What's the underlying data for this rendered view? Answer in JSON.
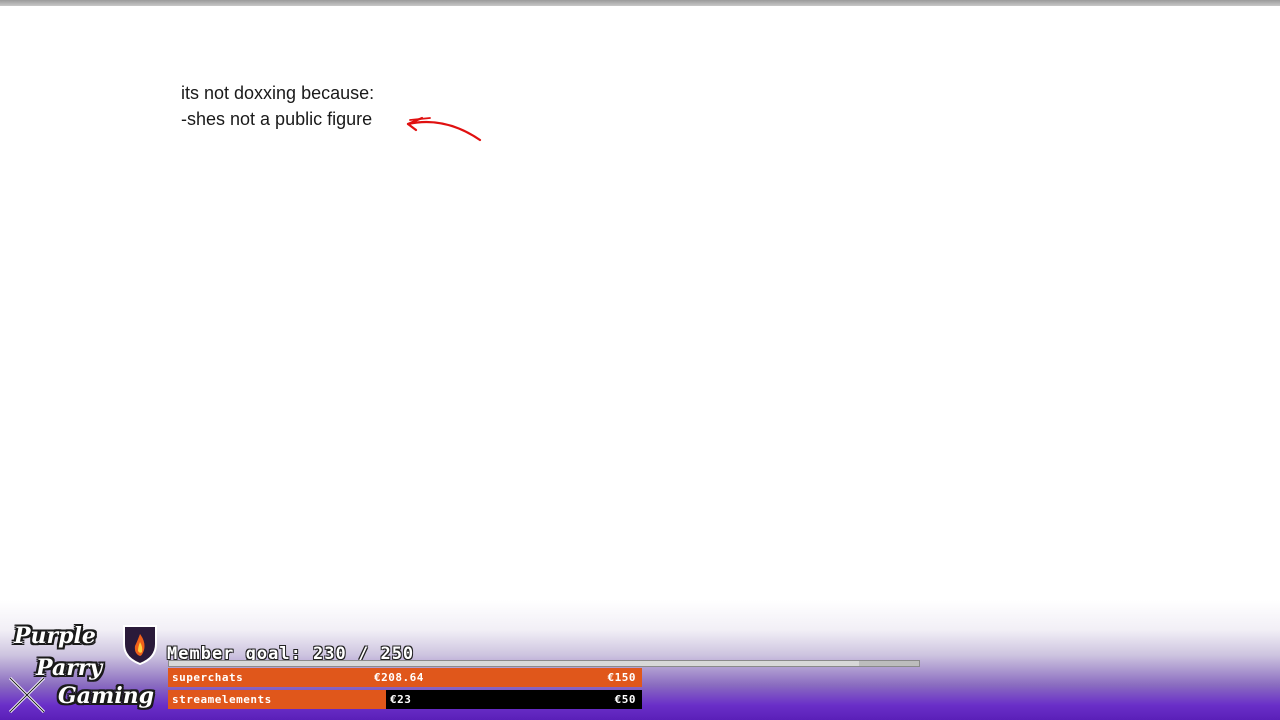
{
  "note": {
    "line1": "its not doxxing because:",
    "line2": "-shes not a public figure"
  },
  "annotation": {
    "arrow_color": "#e01010",
    "icon": "red-arrow-icon"
  },
  "overlay": {
    "logo": {
      "line1": "Purple",
      "line2": "Parry",
      "line3": "Gaming",
      "icon": "shield-flame-icon"
    },
    "member_goal": {
      "text": "Member goal: 230 / 250",
      "current": 230,
      "target": 250
    },
    "superchats": {
      "label": "superchats",
      "amount": "€208.64",
      "goal": "€150",
      "progress": 1.0,
      "color": "#e0571b"
    },
    "streamelements": {
      "label": "streamelements",
      "amount": "€23",
      "goal": "€50",
      "progress": 0.46,
      "color": "#e0571b"
    }
  }
}
